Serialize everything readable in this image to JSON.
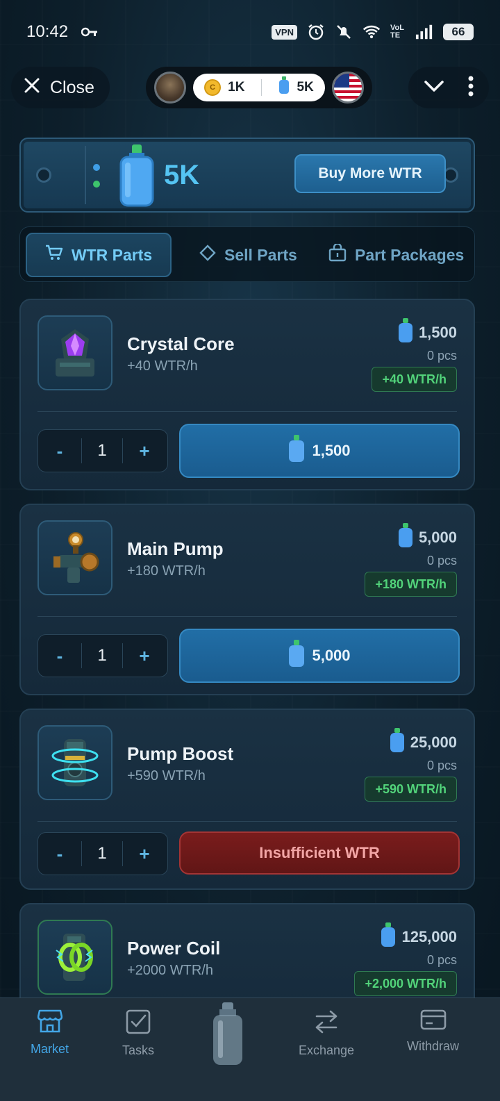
{
  "status_bar": {
    "time": "10:42",
    "vpn": "VPN",
    "network": "VoLTE",
    "battery": "66"
  },
  "header": {
    "close_label": "Close",
    "coins": "1K",
    "wtr": "5K"
  },
  "wtr_panel": {
    "amount": "5K",
    "buy_more_label": "Buy More WTR"
  },
  "tabs": [
    {
      "label": "WTR Parts",
      "active": true
    },
    {
      "label": "Sell Parts",
      "active": false
    },
    {
      "label": "Part Packages",
      "active": false
    }
  ],
  "products": [
    {
      "name": "Crystal Core",
      "rate": "+40 WTR/h",
      "price": "1,500",
      "pcs": "0 pcs",
      "badge": "+40 WTR/h",
      "qty": "1",
      "button": "1,500",
      "affordable": true
    },
    {
      "name": "Main Pump",
      "rate": "+180 WTR/h",
      "price": "5,000",
      "pcs": "0 pcs",
      "badge": "+180 WTR/h",
      "qty": "1",
      "button": "5,000",
      "affordable": true
    },
    {
      "name": "Pump Boost",
      "rate": "+590 WTR/h",
      "price": "25,000",
      "pcs": "0 pcs",
      "badge": "+590 WTR/h",
      "qty": "1",
      "button": "Insufficient WTR",
      "affordable": false
    },
    {
      "name": "Power Coil",
      "rate": "+2000 WTR/h",
      "price": "125,000",
      "pcs": "0 pcs",
      "badge": "+2,000 WTR/h"
    }
  ],
  "stepper": {
    "minus": "-",
    "plus": "+"
  },
  "bottom_nav": [
    {
      "label": "Market",
      "active": true
    },
    {
      "label": "Tasks",
      "active": false
    },
    {
      "label": "Exchange",
      "active": false
    },
    {
      "label": "Withdraw",
      "active": false
    }
  ],
  "colors": {
    "accent": "#43a6e6",
    "positive": "#52d37a",
    "danger": "#7a1c1c",
    "background": "#0d1f2b"
  }
}
